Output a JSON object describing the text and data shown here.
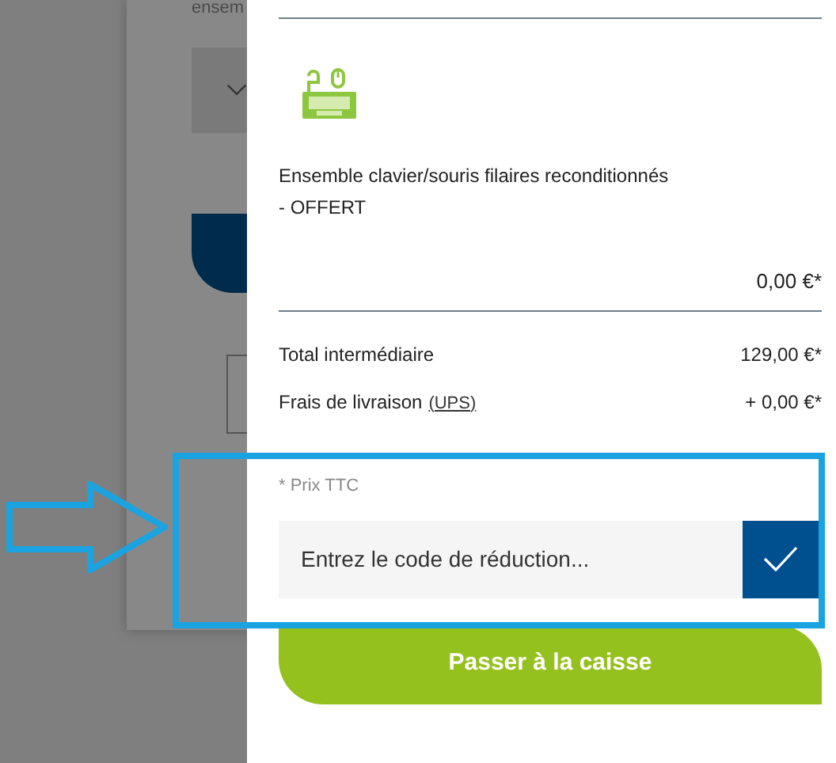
{
  "background_page": {
    "text_fragment": "ensem"
  },
  "cart": {
    "product": {
      "name_lines": [
        "Ensemble clavier/souris filaires reconditionnés",
        "- OFFERT"
      ],
      "price": "0,00 €*"
    },
    "totals": [
      {
        "label": "Total intermédiaire",
        "value": "129,00 €*"
      },
      {
        "label": "Frais de livraison",
        "link": "(UPS)",
        "value": "+ 0,00 €*"
      }
    ],
    "note": "* Prix TTC",
    "discount": {
      "placeholder": "Entrez le code de réduction..."
    },
    "checkout_button": "Passer à la caisse"
  }
}
